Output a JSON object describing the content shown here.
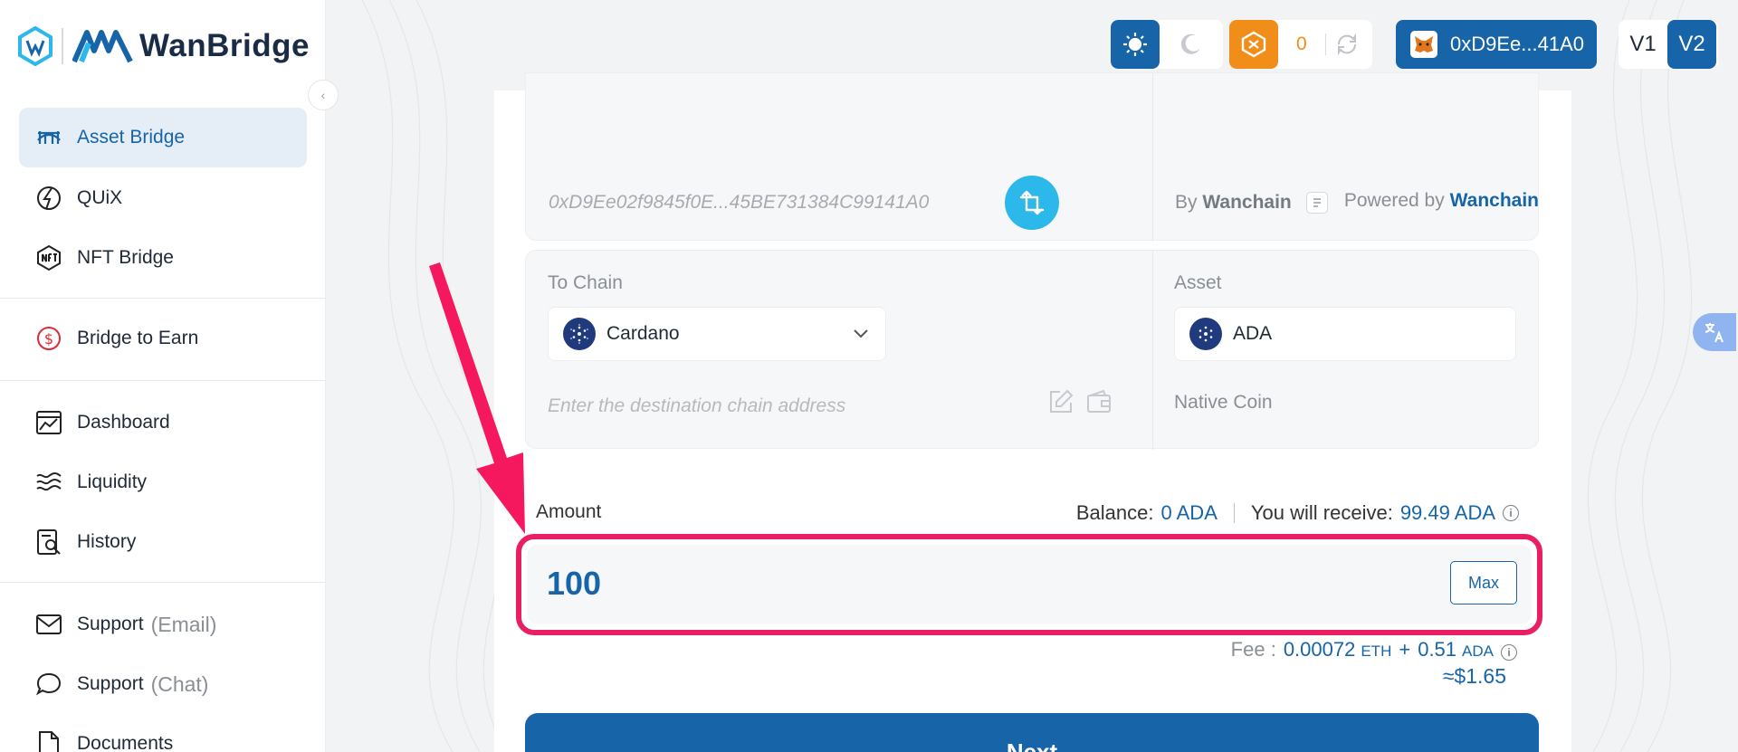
{
  "app": {
    "name": "WanBridge"
  },
  "sidebar": {
    "items": [
      {
        "label": "Asset Bridge",
        "icon": "bridge-icon",
        "active": true
      },
      {
        "label": "QUiX",
        "icon": "quix-icon"
      },
      {
        "label": "NFT Bridge",
        "icon": "nft-icon"
      },
      {
        "label": "Bridge to Earn",
        "icon": "dollar-circle-icon"
      },
      {
        "label": "Dashboard",
        "icon": "dashboard-icon"
      },
      {
        "label": "Liquidity",
        "icon": "waves-icon"
      },
      {
        "label": "History",
        "icon": "history-icon"
      },
      {
        "label": "Support",
        "muted": "(Email)",
        "icon": "mail-icon"
      },
      {
        "label": "Support",
        "muted": "(Chat)",
        "icon": "chat-icon"
      },
      {
        "label": "Documents",
        "icon": "document-icon"
      }
    ]
  },
  "topbar": {
    "points": "0",
    "wallet": "0xD9Ee...41A0",
    "v1": "V1",
    "v2": "V2"
  },
  "from": {
    "address": "0xD9Ee02f9845f0E...45BE731384C99141A0",
    "by_prefix": "By",
    "by_name": "Wanchain"
  },
  "powered": {
    "prefix": "Powered by",
    "name": "Wanchain"
  },
  "to": {
    "chain_label": "To Chain",
    "chain_value": "Cardano",
    "asset_label": "Asset",
    "asset_value": "ADA",
    "dest_placeholder": "Enter the destination chain address",
    "asset_type": "Native Coin"
  },
  "amount": {
    "label": "Amount",
    "balance_label": "Balance:",
    "balance_value": "0 ADA",
    "receive_label": "You will receive:",
    "receive_value": "99.49 ADA",
    "value": "100",
    "max": "Max"
  },
  "fee": {
    "label": "Fee :",
    "eth_value": "0.00072",
    "eth_unit": "ETH",
    "plus": "+",
    "ada_value": "0.51",
    "ada_unit": "ADA",
    "usd": "≈$1.65"
  },
  "next_label": "Next",
  "colors": {
    "primary": "#1765a8",
    "accent": "#2db8eb",
    "highlight": "#e91e63",
    "orange": "#f18e1a"
  }
}
